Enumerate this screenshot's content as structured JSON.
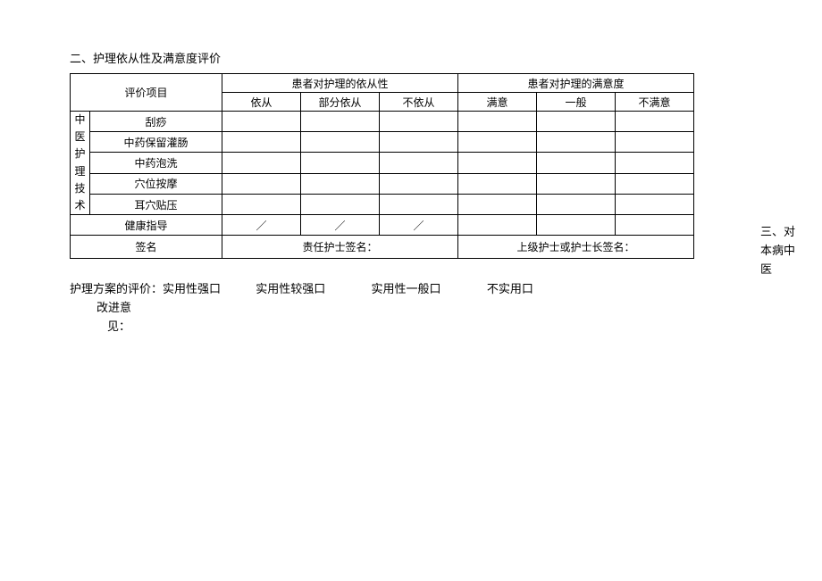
{
  "title": "二、护理依从性及满意度评价",
  "table": {
    "hdr_item": "评价项目",
    "hdr_compliance": "患者对护理的依从性",
    "hdr_satisfaction": "患者对护理的满意度",
    "sub_compliance": [
      "依从",
      "部分依从",
      "不依从"
    ],
    "sub_satisfaction": [
      "满意",
      "一般",
      "不满意"
    ],
    "vert_label": [
      "中",
      "医",
      "护",
      "理",
      "技",
      "术"
    ],
    "rows": [
      "刮痧",
      "中药保留灌肠",
      "中药泡洗",
      "穴位按摩",
      "耳穴贴压"
    ],
    "health_label": "健康指导",
    "health_cells": [
      "／",
      "／",
      "／",
      "",
      "",
      ""
    ],
    "sign_label": "签名",
    "sign_left": "责任护士签名：",
    "sign_right": "上级护士或护士长签名："
  },
  "side_note": [
    "三、对",
    "本病中",
    "医"
  ],
  "eval": {
    "label_prefix": "护理方案的评价：",
    "opt1": "实用性强口",
    "indent": "改进意",
    "indent2": "见：",
    "opts": [
      "实用性较强口",
      "实用性一般口",
      "不实用口"
    ]
  }
}
